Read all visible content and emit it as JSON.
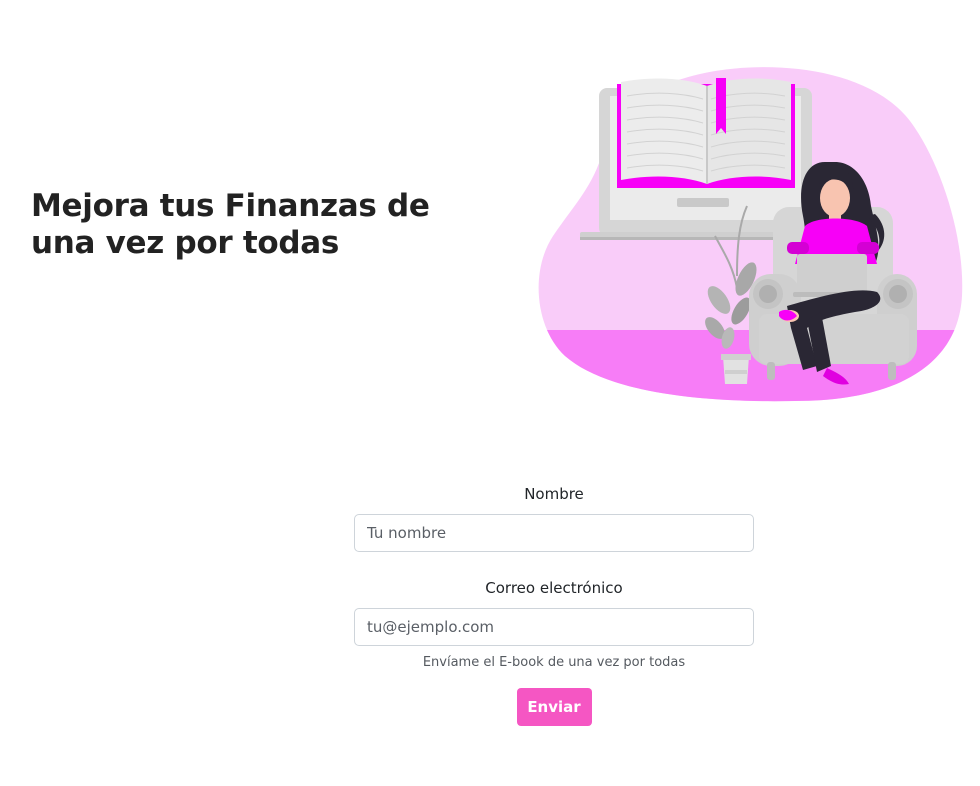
{
  "hero": {
    "title": "Mejora tus Finanzas de una vez por todas"
  },
  "illustration": {
    "name": "woman-reading-ebook-illustration",
    "colors": {
      "blob_light": "#f9ccf9",
      "blob_floor": "#f77df7",
      "accent": "#f700f7",
      "gray": "#d6d6d6"
    }
  },
  "form": {
    "name_label": "Nombre",
    "name_placeholder": "Tu nombre",
    "email_label": "Correo electrónico",
    "email_placeholder": "tu@ejemplo.com",
    "help_text": "Envíame el E-book de una vez por todas",
    "submit_label": "Enviar",
    "submit_color": "#f556c3"
  }
}
